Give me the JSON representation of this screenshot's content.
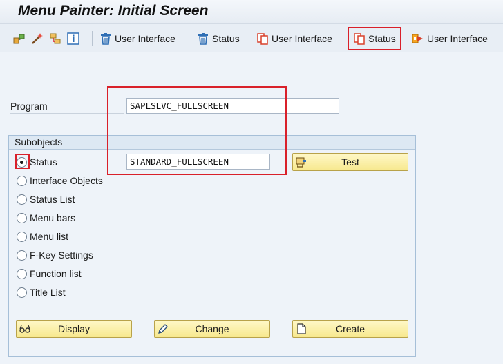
{
  "window": {
    "title": "Menu Painter: Initial Screen"
  },
  "toolbar": {
    "btn1_label": "User Interface",
    "btn2_label": "Status",
    "btn3_label": "User Interface",
    "btn4_label": "Status",
    "btn5_label": "User Interface"
  },
  "form": {
    "program_label": "Program",
    "program_value": "SAPLSLVC_FULLSCREEN",
    "status_value": "STANDARD_FULLSCREEN"
  },
  "subobjects": {
    "header": "Subobjects",
    "options": [
      {
        "label": "Status",
        "selected": true
      },
      {
        "label": "Interface Objects",
        "selected": false
      },
      {
        "label": "Status List",
        "selected": false
      },
      {
        "label": "Menu bars",
        "selected": false
      },
      {
        "label": "Menu list",
        "selected": false
      },
      {
        "label": "F-Key Settings",
        "selected": false
      },
      {
        "label": "Function list",
        "selected": false
      },
      {
        "label": "Title List",
        "selected": false
      }
    ]
  },
  "buttons": {
    "test": "Test",
    "display": "Display",
    "change": "Change",
    "create": "Create"
  },
  "colors": {
    "highlight": "#d9202a",
    "button_fill": "#f7e88e",
    "icon_blue": "#2f6fb5",
    "icon_red": "#d9412b"
  }
}
